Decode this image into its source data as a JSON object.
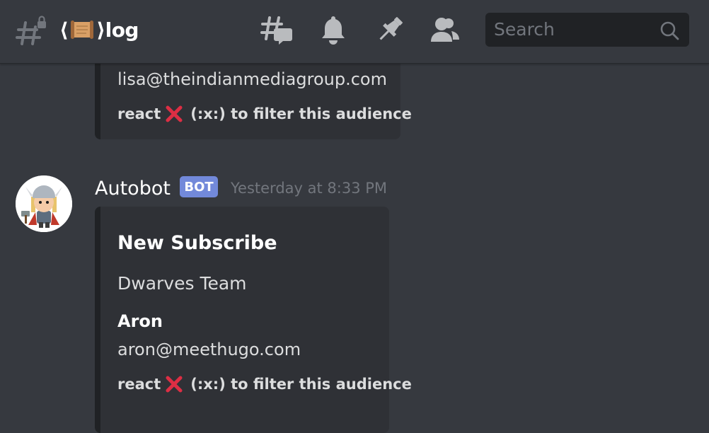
{
  "header": {
    "channel_prefix": "⟨",
    "channel_suffix": "⟩log",
    "search_placeholder": "Search"
  },
  "icons": {
    "channel": "hashtag-lock-icon",
    "threads": "threads-icon",
    "notifications": "bell-icon",
    "pins": "pin-icon",
    "members": "members-icon",
    "search": "search-icon"
  },
  "messages": [
    {
      "embed": {
        "email": "lisa@theindianmediagroup.com",
        "react_prefix": "react",
        "react_suffix": "(:x:) to filter this audience"
      }
    },
    {
      "author": "Autobot",
      "tag": "BOT",
      "timestamp": "Yesterday at 8:33 PM",
      "embed": {
        "title": "New Subscribe",
        "description": "Dwarves Team",
        "field_name": "Aron",
        "field_value": "aron@meethugo.com",
        "react_prefix": "react",
        "react_suffix": "(:x:) to filter this audience"
      }
    }
  ],
  "colors": {
    "background": "#36393f",
    "embed": "#2f3136",
    "bot_tag": "#7289da",
    "muted": "#72767d"
  }
}
